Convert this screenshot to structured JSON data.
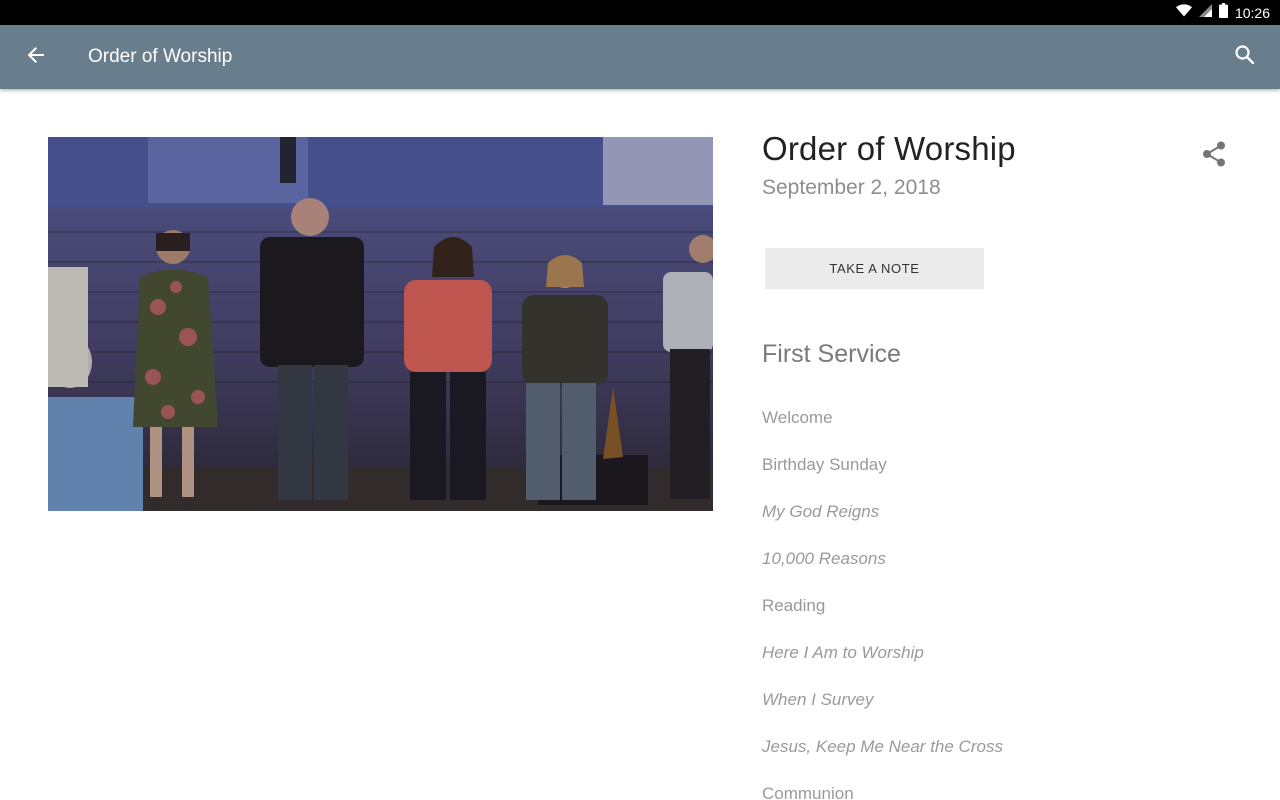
{
  "statusbar": {
    "time": "10:26",
    "icons": [
      "wifi-icon",
      "signal-icon",
      "battery-icon"
    ]
  },
  "appbar": {
    "title": "Order of Worship",
    "back_icon": "arrow-back-icon",
    "search_icon": "search-icon",
    "color": "#687e8d"
  },
  "hero": {
    "image": "worship-team-singing-on-stage-photo"
  },
  "detail": {
    "title": "Order of Worship",
    "date": "September 2, 2018",
    "share_icon": "share-icon",
    "take_note_label": "TAKE A NOTE"
  },
  "service": {
    "title": "First Service",
    "items": [
      {
        "label": "Welcome",
        "type": "text"
      },
      {
        "label": "Birthday Sunday",
        "type": "text"
      },
      {
        "label": "My God Reigns",
        "type": "song"
      },
      {
        "label": "10,000 Reasons",
        "type": "song"
      },
      {
        "label": "Reading",
        "type": "text"
      },
      {
        "label": "Here I Am to Worship",
        "type": "song"
      },
      {
        "label": "When I Survey",
        "type": "song"
      },
      {
        "label": "Jesus, Keep Me Near the Cross",
        "type": "song"
      },
      {
        "label": "Communion",
        "type": "text"
      }
    ]
  }
}
